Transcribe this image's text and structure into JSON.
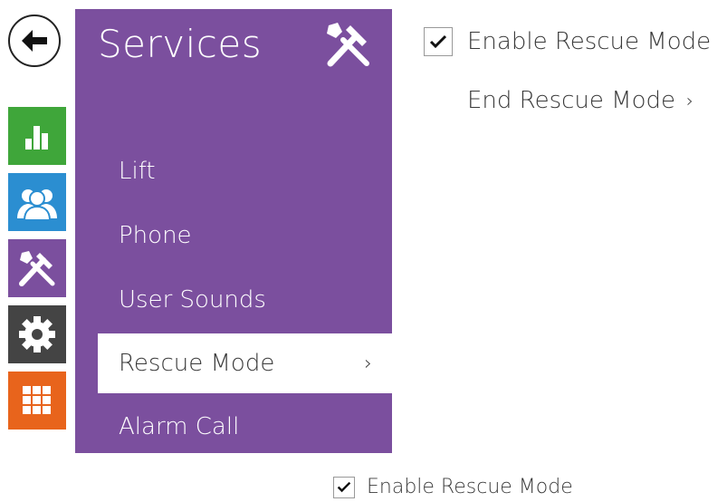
{
  "panel": {
    "title": "Services",
    "icon": "tools-icon",
    "color": "#7b4f9e"
  },
  "rail": {
    "items": [
      {
        "name": "status",
        "icon": "bar-chart-icon",
        "color": "#3fa63a"
      },
      {
        "name": "directory",
        "icon": "users-icon",
        "color": "#2b8ed1"
      },
      {
        "name": "services",
        "icon": "tools-icon",
        "color": "#7b4f9e"
      },
      {
        "name": "hardware",
        "icon": "gear-icon",
        "color": "#444444"
      },
      {
        "name": "system",
        "icon": "grid-icon",
        "color": "#e8641c"
      }
    ]
  },
  "menu": {
    "items": [
      {
        "label": "Lift"
      },
      {
        "label": "Phone"
      },
      {
        "label": "User Sounds"
      },
      {
        "label": "Rescue Mode",
        "active": true,
        "chevron": "›"
      },
      {
        "label": "Alarm Call"
      }
    ]
  },
  "content": {
    "enable_label": "Enable Rescue Mode",
    "enable_checked": true,
    "end_label": "End Rescue Mode",
    "end_chevron": "›"
  },
  "caption": {
    "enable_label": "Enable Rescue Mode",
    "enable_checked": true
  }
}
